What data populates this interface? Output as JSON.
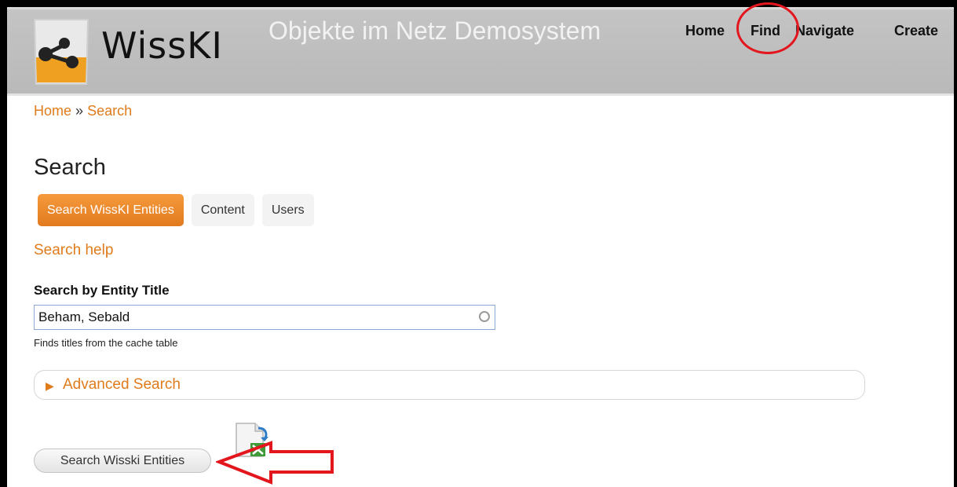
{
  "header": {
    "logo_text": "WissKI",
    "site_name": "Objekte im Netz Demosystem",
    "nav": {
      "home": "Home",
      "find": "Find",
      "navigate": "Navigate",
      "create": "Create"
    }
  },
  "breadcrumb": {
    "home": "Home",
    "separator": "»",
    "current": "Search"
  },
  "page": {
    "title": "Search"
  },
  "tabs": [
    {
      "label": "Search WissKI Entities",
      "active": true
    },
    {
      "label": "Content",
      "active": false
    },
    {
      "label": "Users",
      "active": false
    }
  ],
  "help_link": "Search help",
  "search_form": {
    "label": "Search by Entity Title",
    "value": "Beham, Sebald",
    "description": "Finds titles from the cache table",
    "advanced_label": "Advanced Search",
    "submit_label": "Search Wisski Entities"
  },
  "colors": {
    "accent": "#e07b1c",
    "annotation": "#e3161e",
    "header_bg": "#c0c0c0"
  },
  "icons": {
    "logo": "wisski-glass-logo",
    "export": "export-document-icon",
    "expand": "triangle-right-icon",
    "clear": "circle-icon"
  },
  "annotations": {
    "find_highlight": "red-circle",
    "submit_pointer": "red-arrow"
  }
}
